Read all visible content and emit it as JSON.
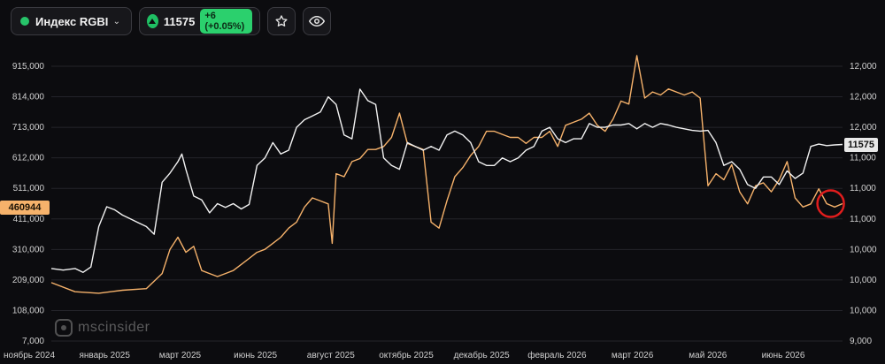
{
  "toolbar": {
    "symbol": "Индекс RGBI",
    "price": "11575",
    "change": "+6 (+0.05%)"
  },
  "colors": {
    "white_series": "#f2f2f2",
    "orange_series": "#f6b26b",
    "up": "#27c46a",
    "marker": "#e01d1d"
  },
  "icons": [
    "status-dot",
    "chevron-down-icon",
    "arrow-up-icon",
    "star-icon",
    "eye-icon"
  ],
  "badges": {
    "left_value": "460944",
    "right_value": "11575"
  },
  "watermark": "mscinsider",
  "chart_data": {
    "type": "line",
    "left_axis": {
      "ticks": [
        "915,000",
        "814,000",
        "713,000",
        "612,000",
        "511,000",
        "411,000",
        "310,000",
        "209,000",
        "108,000",
        "7,000"
      ],
      "range": [
        7000,
        915000
      ]
    },
    "right_axis": {
      "ticks": [
        "12,000",
        "12,000",
        "12,000",
        "11,000",
        "11,000",
        "11,000",
        "10,000",
        "10,000",
        "10,000",
        "9,000"
      ],
      "range": [
        9000,
        12600
      ]
    },
    "x_axis_labels": [
      "ноябрь 2024",
      "январь 2025",
      "март 2025",
      "июнь 2025",
      "август 2025",
      "октябрь 2025",
      "декабрь 2025",
      "февраль 2026",
      "март 2026",
      "май 2026",
      "июнь 2026"
    ],
    "x_range": [
      0,
      100
    ],
    "series": [
      {
        "color": "#f2f2f2",
        "axis": "right",
        "x": [
          0,
          1.5,
          3,
          4,
          5,
          6,
          7,
          8,
          9,
          10,
          11,
          12,
          13,
          14,
          15,
          16,
          16.5,
          17,
          18,
          19,
          20,
          21,
          22,
          23,
          24,
          25,
          26,
          27,
          28,
          29,
          30,
          31,
          32,
          33,
          34,
          35,
          36,
          37,
          38,
          39,
          40,
          41,
          42,
          43,
          44,
          45,
          46,
          47,
          48,
          49,
          50,
          51,
          52,
          53,
          54,
          55,
          56,
          57,
          58,
          59,
          60,
          61,
          62,
          63,
          64,
          65,
          66,
          67,
          68,
          69,
          70,
          71,
          72,
          73,
          74,
          75,
          76,
          77,
          78,
          79,
          80,
          81,
          82,
          83,
          84,
          85,
          86,
          87,
          88,
          89,
          90,
          91,
          92,
          93,
          94,
          95,
          96,
          97,
          98,
          99,
          100
        ],
        "y": [
          9950,
          9930,
          9950,
          9900,
          9970,
          10500,
          10760,
          10720,
          10650,
          10600,
          10550,
          10500,
          10400,
          11080,
          11200,
          11350,
          11450,
          11250,
          10900,
          10850,
          10680,
          10800,
          10750,
          10800,
          10730,
          10790,
          11300,
          11400,
          11600,
          11450,
          11500,
          11800,
          11900,
          11950,
          12000,
          12200,
          12100,
          11700,
          11650,
          12300,
          12150,
          12100,
          11400,
          11300,
          11250,
          11600,
          11550,
          11500,
          11550,
          11500,
          11700,
          11750,
          11700,
          11600,
          11350,
          11300,
          11300,
          11400,
          11350,
          11400,
          11500,
          11550,
          11750,
          11800,
          11650,
          11600,
          11650,
          11650,
          11850,
          11800,
          11800,
          11830,
          11830,
          11850,
          11780,
          11850,
          11800,
          11850,
          11830,
          11800,
          11780,
          11760,
          11750,
          11760,
          11600,
          11300,
          11350,
          11250,
          11050,
          11000,
          11150,
          11150,
          11050,
          11230,
          11130,
          11200,
          11550,
          11580,
          11560,
          11570,
          11575
        ]
      },
      {
        "color": "#f6b26b",
        "axis": "left",
        "x": [
          0,
          3,
          6,
          9,
          12,
          14,
          15,
          16,
          17,
          18,
          19,
          20,
          21,
          22,
          23,
          24,
          25,
          26,
          27,
          28,
          29,
          30,
          31,
          32,
          33,
          34,
          35,
          35.5,
          36,
          37,
          38,
          39,
          40,
          41,
          42,
          43,
          44,
          45,
          46,
          47,
          48,
          49,
          50,
          51,
          52,
          53,
          54,
          55,
          56,
          57,
          58,
          59,
          60,
          61,
          62,
          63,
          64,
          65,
          66,
          67,
          68,
          69,
          70,
          71,
          72,
          73,
          74,
          75,
          76,
          77,
          78,
          79,
          80,
          81,
          82,
          83,
          84,
          85,
          86,
          87,
          88,
          89,
          90,
          91,
          92,
          93,
          94,
          95,
          96,
          97,
          98,
          99,
          100
        ],
        "y": [
          200000,
          170000,
          165000,
          175000,
          180000,
          230000,
          310000,
          350000,
          300000,
          320000,
          240000,
          230000,
          220000,
          230000,
          240000,
          260000,
          280000,
          300000,
          310000,
          330000,
          350000,
          380000,
          400000,
          450000,
          480000,
          470000,
          460000,
          330000,
          560000,
          550000,
          600000,
          610000,
          640000,
          640000,
          650000,
          680000,
          760000,
          660000,
          650000,
          640000,
          400000,
          380000,
          470000,
          550000,
          580000,
          620000,
          650000,
          700000,
          700000,
          690000,
          680000,
          680000,
          660000,
          680000,
          680000,
          700000,
          650000,
          720000,
          730000,
          740000,
          760000,
          720000,
          700000,
          740000,
          800000,
          790000,
          950000,
          810000,
          830000,
          820000,
          840000,
          830000,
          820000,
          830000,
          810000,
          520000,
          560000,
          540000,
          590000,
          500000,
          460000,
          520000,
          530000,
          500000,
          540000,
          600000,
          480000,
          450000,
          460000,
          510000,
          460944,
          450000,
          460944
        ]
      }
    ],
    "marker": {
      "series_index": 1,
      "x": 98.5
    }
  }
}
